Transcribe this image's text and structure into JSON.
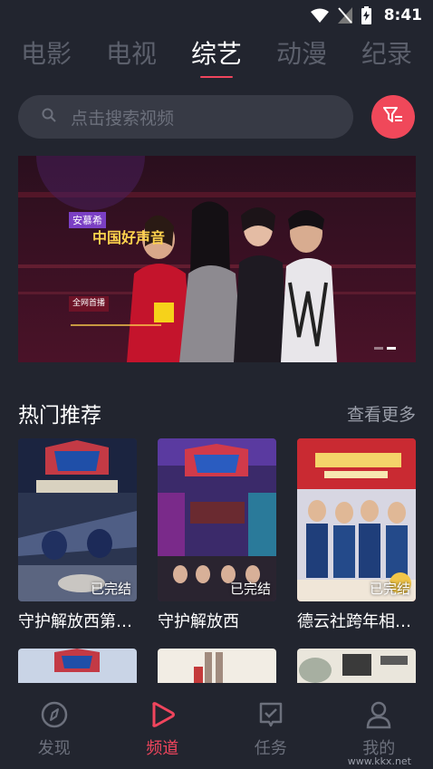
{
  "status_bar": {
    "time": "8:41"
  },
  "category_tabs": [
    {
      "label": "电影"
    },
    {
      "label": "电视"
    },
    {
      "label": "综艺",
      "active": true
    },
    {
      "label": "动漫"
    },
    {
      "label": "纪录"
    }
  ],
  "search": {
    "placeholder": "点击搜索视频"
  },
  "banner": {
    "brand": "安慕希",
    "show_title": "中国好声音",
    "tagline": "全网首播"
  },
  "hot": {
    "title": "热门推荐",
    "more": "查看更多",
    "items": [
      {
        "title": "守护解放西第…",
        "status": "已完结"
      },
      {
        "title": "守护解放西",
        "status": "已完结"
      },
      {
        "title": "德云社跨年相…",
        "status": "已完结"
      }
    ]
  },
  "bottom_nav": [
    {
      "label": "发现",
      "icon": "compass-icon"
    },
    {
      "label": "频道",
      "icon": "play-icon",
      "active": true
    },
    {
      "label": "任务",
      "icon": "task-check-icon"
    },
    {
      "label": "我的",
      "icon": "person-icon"
    }
  ],
  "watermark": "www.kkx.net",
  "colors": {
    "accent": "#f0455d",
    "background": "#22252f",
    "search_bg": "#373a45"
  }
}
